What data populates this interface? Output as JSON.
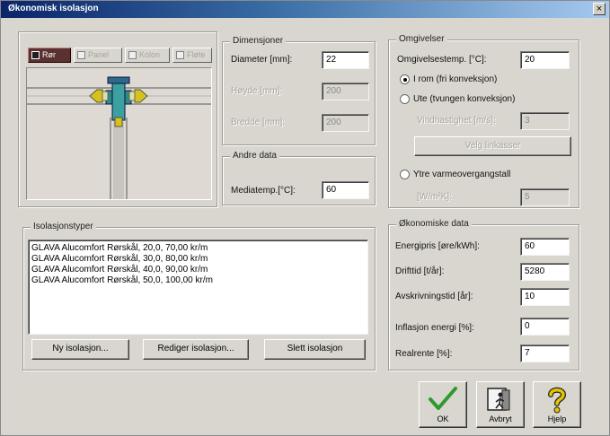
{
  "window": {
    "title": "Økonomisk isolasjon",
    "close_label": "×"
  },
  "tabs": [
    {
      "label": "Rør",
      "active": true
    },
    {
      "label": "Panel",
      "active": false
    },
    {
      "label": "Kolon",
      "active": false
    },
    {
      "label": "Fløte",
      "active": false
    }
  ],
  "dimensjoner": {
    "title": "Dimensjoner",
    "diameter_label": "Diameter [mm]:",
    "diameter_value": "22",
    "hoyde_label": "Høyde [mm]:",
    "hoyde_value": "200",
    "bredde_label": "Bredde [mm]:",
    "bredde_value": "200"
  },
  "andre_data": {
    "title": "Andre data",
    "mediatemp_label": "Mediatemp.[°C]:",
    "mediatemp_value": "60"
  },
  "omgivelser": {
    "title": "Omgivelser",
    "omgivelsestemp_label": "Omgivelsestemp. [°C]:",
    "omgivelsestemp_value": "20",
    "radio_1": "I rom (fri konveksjon)",
    "radio_2": "Ute (tvungen konveksjon)",
    "vindhastighet_label": "Vindhastighet [m/s]:",
    "vindhastighet_value": "3",
    "velg_button": "Velg linkasser",
    "radio_3": "Ytre varmeovergangstall",
    "ytre_label": "[W/m²K]:",
    "ytre_value": "5"
  },
  "isolasjonstyper": {
    "title": "Isolasjonstyper",
    "items": [
      "GLAVA Alucomfort Rørskål, 20,0, 70,00 kr/m",
      "GLAVA Alucomfort Rørskål, 30,0, 80,00 kr/m",
      "GLAVA Alucomfort Rørskål, 40,0, 90,00 kr/m",
      "GLAVA Alucomfort Rørskål, 50,0, 100,00 kr/m"
    ],
    "ny_button": "Ny isolasjon...",
    "rediger_button": "Rediger isolasjon...",
    "slett_button": "Slett isolasjon"
  },
  "okonomiske": {
    "title": "Økonomiske data",
    "energipris_label": "Energipris [øre/kWh]:",
    "energipris_value": "60",
    "drifttid_label": "Drifttid [t/år]:",
    "drifttid_value": "5280",
    "avskrivning_label": "Avskrivningstid [år]:",
    "avskrivning_value": "10",
    "inflasjon_label": "Inflasjon energi [%]:",
    "inflasjon_value": "0",
    "realrente_label": "Realrente [%]:",
    "realrente_value": "7"
  },
  "buttons": {
    "ok": "OK",
    "avbryt": "Avbryt",
    "hjelp": "Hjelp"
  },
  "colors": {
    "titlebar": "#0a246a",
    "check": "#2e9a2e",
    "help": "#e6c400"
  }
}
